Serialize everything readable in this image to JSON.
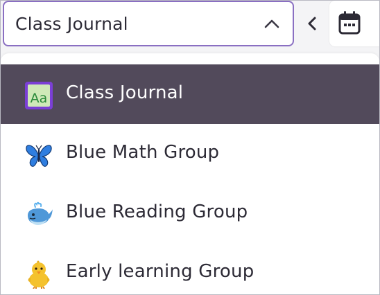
{
  "select": {
    "value": "Class Journal"
  },
  "icons": {
    "chevron": "chevron-up-icon",
    "prev": "chevron-left-icon",
    "calendar": "calendar-icon"
  },
  "colors": {
    "accent_border": "#8a6fc2",
    "active_bg": "#524a5b",
    "active_text": "#ffffff",
    "text": "#2c2a35"
  },
  "options": [
    {
      "label": "Class Journal",
      "icon": "font-book-icon",
      "selected": true,
      "icon_text": "Aa"
    },
    {
      "label": "Blue Math Group",
      "icon": "butterfly-icon",
      "selected": false
    },
    {
      "label": "Blue Reading Group",
      "icon": "whale-icon",
      "selected": false
    },
    {
      "label": "Early learning Group",
      "icon": "chick-icon",
      "selected": false
    }
  ]
}
